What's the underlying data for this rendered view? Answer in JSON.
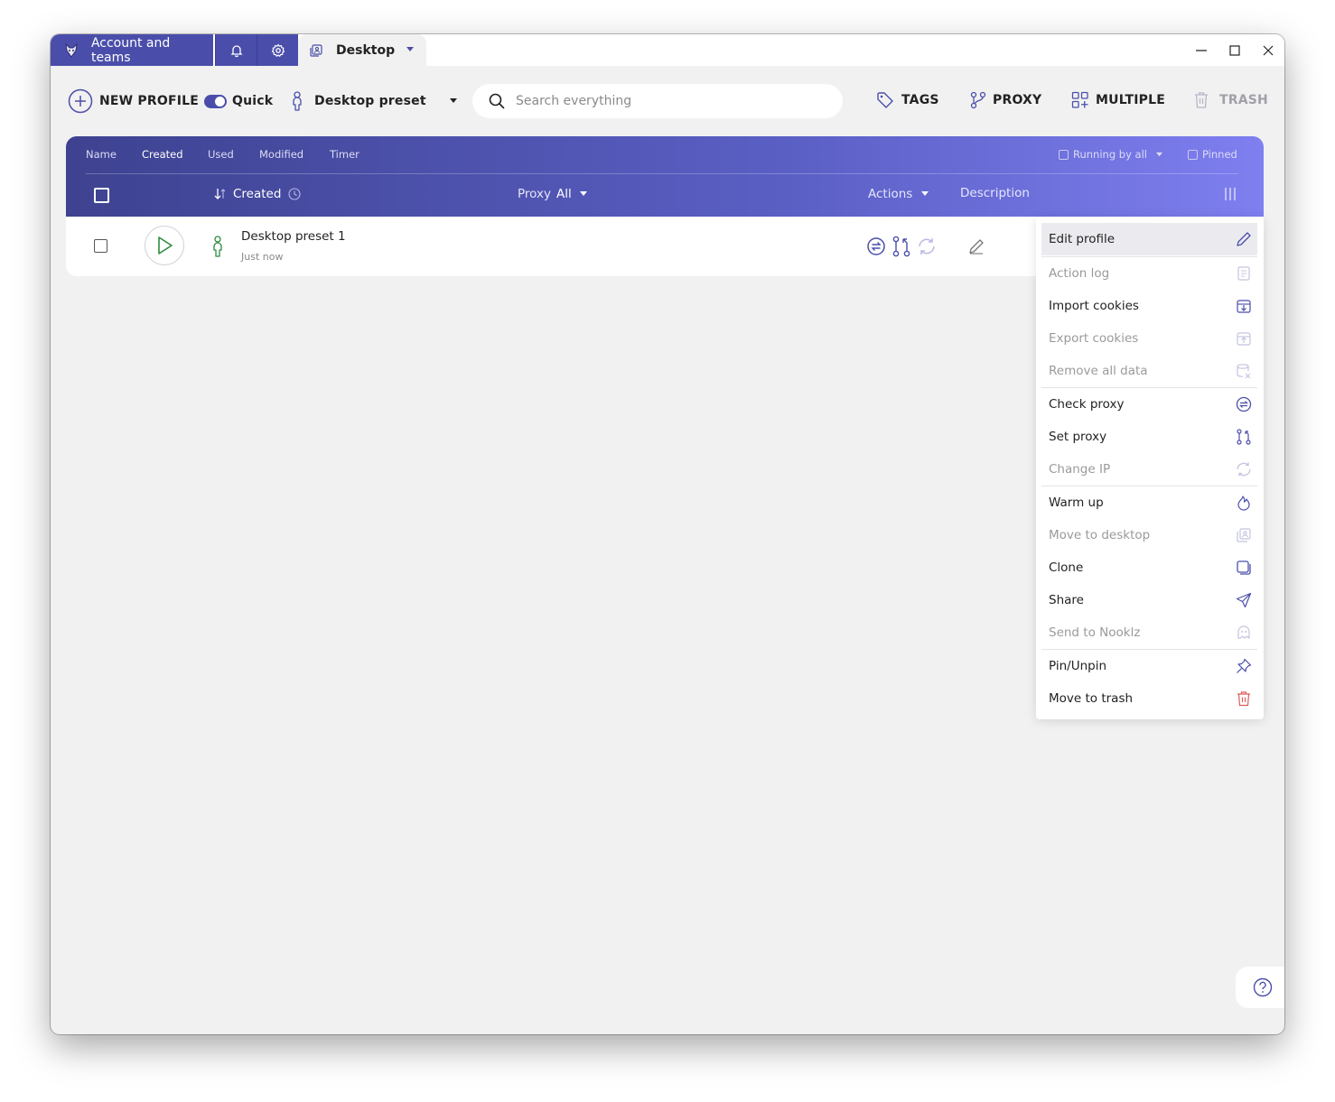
{
  "titlebar": {
    "account_tab_label": "Account and teams",
    "desktop_tab_label": "Desktop"
  },
  "toolbar": {
    "new_profile_label": "NEW PROFILE",
    "quick_label": "Quick",
    "preset_label": "Desktop preset",
    "search_placeholder": "Search everything",
    "tags_label": "TAGS",
    "proxy_label": "PROXY",
    "multiple_label": "MULTIPLE",
    "trash_label": "TRASH"
  },
  "table": {
    "sort_tabs": [
      "Name",
      "Created",
      "Used",
      "Modified",
      "Timer"
    ],
    "active_sort": "Created",
    "running_by_all_label": "Running by all",
    "pinned_label": "Pinned",
    "columns": {
      "created": "Created",
      "proxy": "Proxy",
      "proxy_filter": "All",
      "actions": "Actions",
      "description": "Description"
    },
    "rows": [
      {
        "name": "Desktop preset 1",
        "time": "Just now"
      }
    ]
  },
  "context_menu": {
    "items": [
      {
        "label": "Edit profile",
        "enabled": true,
        "icon": "pencil-icon"
      },
      {
        "label": "Action log",
        "enabled": false,
        "icon": "log-icon"
      },
      {
        "label": "Import cookies",
        "enabled": true,
        "icon": "import-cookies-icon"
      },
      {
        "label": "Export cookies",
        "enabled": false,
        "icon": "export-cookies-icon"
      },
      {
        "label": "Remove all data",
        "enabled": false,
        "icon": "remove-data-icon"
      },
      {
        "label": "Check proxy",
        "enabled": true,
        "icon": "check-proxy-icon"
      },
      {
        "label": "Set proxy",
        "enabled": true,
        "icon": "set-proxy-icon"
      },
      {
        "label": "Change IP",
        "enabled": false,
        "icon": "change-ip-icon"
      },
      {
        "label": "Warm up",
        "enabled": true,
        "icon": "fire-icon"
      },
      {
        "label": "Move to desktop",
        "enabled": false,
        "icon": "desktop-icon"
      },
      {
        "label": "Clone",
        "enabled": true,
        "icon": "clone-icon"
      },
      {
        "label": "Share",
        "enabled": true,
        "icon": "send-icon"
      },
      {
        "label": "Send to Nooklz",
        "enabled": false,
        "icon": "nooklz-icon"
      },
      {
        "label": "Pin/Unpin",
        "enabled": true,
        "icon": "pin-icon"
      },
      {
        "label": "Move to trash",
        "enabled": true,
        "icon": "trash-icon"
      }
    ]
  },
  "colors": {
    "brand": "#4a4eaa",
    "header_gradient_end": "#7f7ff0",
    "profile_green": "#2e8b3e",
    "danger": "#e05a5a"
  }
}
